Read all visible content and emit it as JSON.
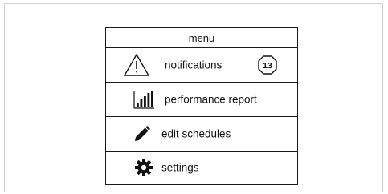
{
  "menu": {
    "title": "menu",
    "items": [
      {
        "label": "notifications",
        "icon": "warning-icon",
        "badge": "13"
      },
      {
        "label": "performance report",
        "icon": "bar-chart-icon"
      },
      {
        "label": "edit schedules",
        "icon": "pencil-icon"
      },
      {
        "label": "settings",
        "icon": "gear-icon"
      }
    ]
  }
}
